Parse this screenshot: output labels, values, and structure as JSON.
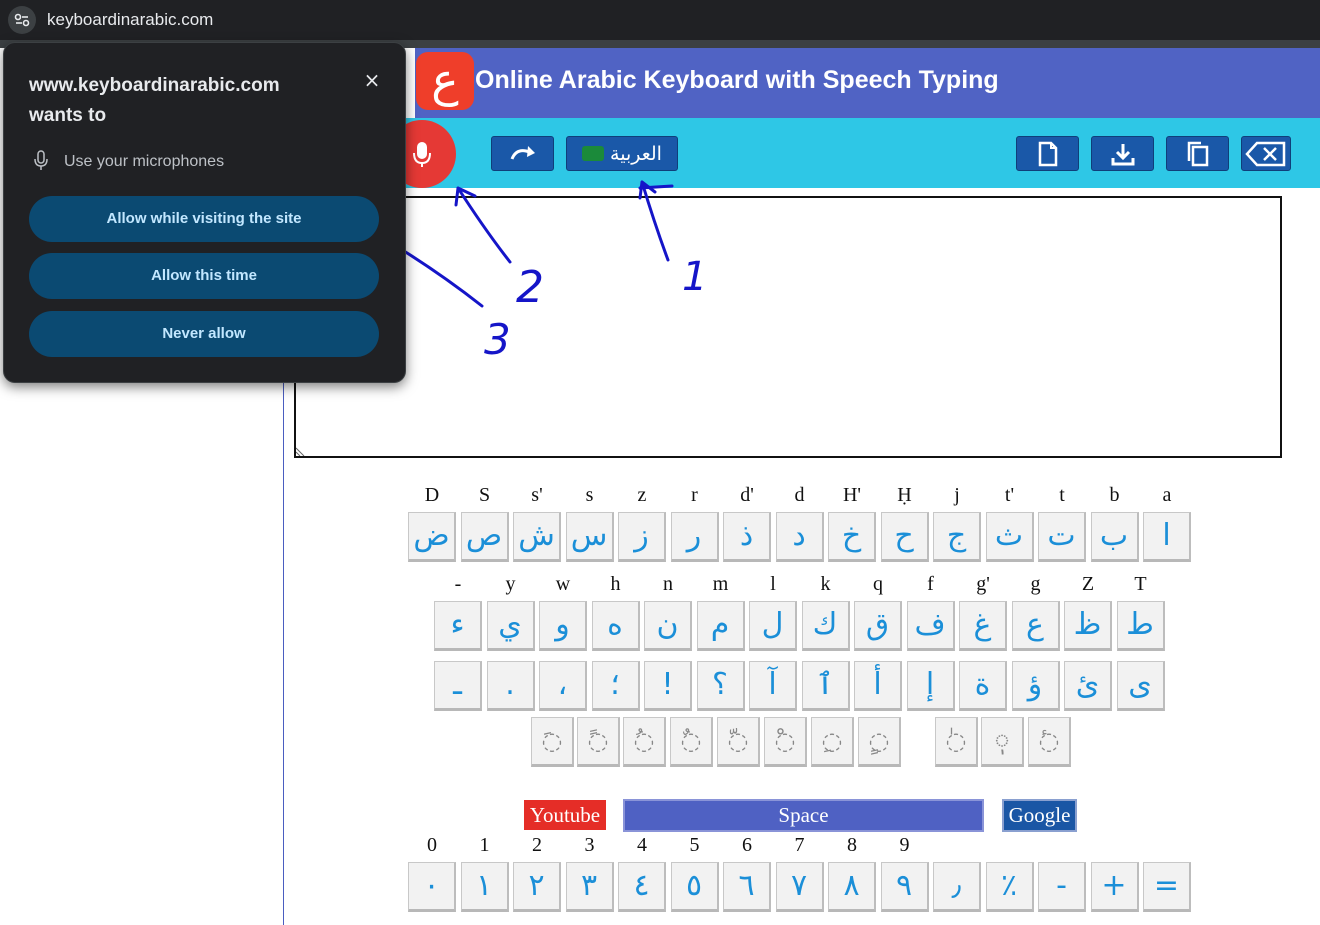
{
  "browser": {
    "url": "keyboardinarabic.com"
  },
  "site": {
    "title": "Online Arabic Keyboard with Speech Typing",
    "logo_glyph": "ع",
    "lang_button": "العربية",
    "textarea_value": ""
  },
  "popup": {
    "title": "www.keyboardinarabic.com wants to",
    "permission": "Use your microphones",
    "btn_allow_visit": "Allow while visiting the site",
    "btn_allow_once": "Allow this time",
    "btn_never": "Never allow",
    "close": "×"
  },
  "keyboard": {
    "row1_labels": [
      "D",
      "S",
      "s'",
      "s",
      "z",
      "r",
      "d'",
      "d",
      "H'",
      "Ḥ",
      "j",
      "t'",
      "t",
      "b",
      "a"
    ],
    "row1_keys": [
      "ض",
      "ص",
      "ش",
      "س",
      "ز",
      "ر",
      "ذ",
      "د",
      "خ",
      "ح",
      "ج",
      "ث",
      "ت",
      "ب",
      "ا"
    ],
    "row2_labels": [
      "-",
      "y",
      "w",
      "h",
      "n",
      "m",
      "l",
      "k",
      "q",
      "f",
      "g'",
      "g",
      "Z",
      "T"
    ],
    "row2_keys": [
      "ء",
      "ي",
      "و",
      "ه",
      "ن",
      "م",
      "ل",
      "ك",
      "ق",
      "ف",
      "غ",
      "ع",
      "ظ",
      "ط"
    ],
    "row3_keys": [
      "ـ",
      ".",
      "،",
      "؛",
      "!",
      "؟",
      "آ",
      "ٱ",
      "أ",
      "إ",
      "ة",
      "ؤ",
      "ئ",
      "ى"
    ],
    "row4_keys": [
      "◌َ",
      "◌ً",
      "◌ُ",
      "◌ٌ",
      "◌ّ",
      "◌ْ",
      "◌ِ",
      "◌ٍ",
      "◌ٰ",
      "◌ٖ",
      "◌ٔ"
    ],
    "youtube": "Youtube",
    "space": "Space",
    "google": "Google",
    "num_labels": [
      "0",
      "1",
      "2",
      "3",
      "4",
      "5",
      "6",
      "7",
      "8",
      "9"
    ],
    "num_keys": [
      "٠",
      "١",
      "٢",
      "٣",
      "٤",
      "٥",
      "٦",
      "٧",
      "٨",
      "٩",
      "٫",
      "٪",
      "-",
      "+",
      "="
    ]
  },
  "annotations": [
    "2",
    "1",
    "3"
  ]
}
